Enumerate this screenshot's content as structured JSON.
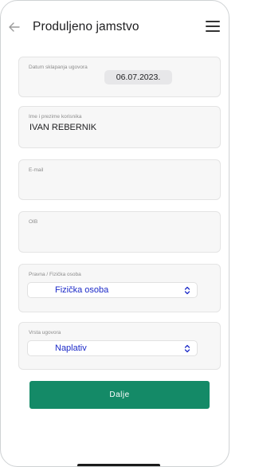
{
  "header": {
    "title": "Produljeno jamstvo",
    "back_icon": "arrow-left-icon",
    "menu_icon": "hamburger-menu-icon"
  },
  "form": {
    "contract_date": {
      "label": "Datum sklapanja ugovora",
      "value": "06.07.2023."
    },
    "user_name": {
      "label": "Ime i prezime korisnika",
      "value": "IVAN REBERNIK"
    },
    "email": {
      "label": "E-mail",
      "value": ""
    },
    "oib": {
      "label": "OIB",
      "value": ""
    },
    "person_type": {
      "label": "Pravna / Fizička osoba",
      "selected": "Fizička osoba"
    },
    "contract_type": {
      "label": "Vrsta ugovora",
      "selected": "Naplativ"
    }
  },
  "actions": {
    "submit_label": "Dalje"
  },
  "colors": {
    "accent": "#148a67",
    "select_text": "#1c2ac8",
    "field_background": "#f7f7f7"
  }
}
